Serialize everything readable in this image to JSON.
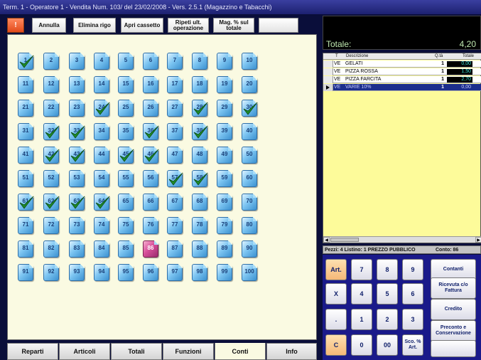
{
  "window": {
    "title": "Term. 1 - Operatore 1 - Vendita Num. 103/ del 23/02/2008 - Vers. 2.5.1 (Magazzino e Tabacchi)"
  },
  "toolbar": {
    "red_button": "!",
    "buttons": [
      "Annulla",
      "Elimina rigo",
      "Apri cassetto",
      "Ripeti ult. operazione",
      "Mag. % sul totale",
      ""
    ]
  },
  "grid": {
    "numbers": [
      "1",
      "2",
      "3",
      "4",
      "5",
      "6",
      "7",
      "8",
      "9",
      "10",
      "11",
      "12",
      "13",
      "14",
      "15",
      "16",
      "17",
      "18",
      "19",
      "20",
      "21",
      "22",
      "23",
      "24",
      "25",
      "26",
      "27",
      "28",
      "29",
      "30",
      "31",
      "32",
      "33",
      "34",
      "35",
      "36",
      "37",
      "38",
      "39",
      "40",
      "41",
      "42",
      "43",
      "44",
      "45",
      "46",
      "47",
      "48",
      "49",
      "50",
      "51",
      "52",
      "53",
      "54",
      "55",
      "56",
      "57",
      "58",
      "59",
      "60",
      "61",
      "62",
      "63",
      "64",
      "65",
      "66",
      "67",
      "68",
      "69",
      "70",
      "71",
      "72",
      "73",
      "74",
      "75",
      "76",
      "77",
      "78",
      "79",
      "80",
      "81",
      "82",
      "83",
      "84",
      "85",
      "86",
      "87",
      "88",
      "89",
      "90",
      "91",
      "92",
      "93",
      "94",
      "95",
      "96",
      "97",
      "98",
      "99",
      "100"
    ],
    "checked": [
      1,
      24,
      28,
      30,
      32,
      33,
      36,
      38,
      42,
      43,
      45,
      46,
      57,
      58,
      61,
      62,
      63,
      64
    ],
    "selected": 86,
    "tile_color": "#5aaee6",
    "check_color": "#1e8c2a"
  },
  "tabs": [
    "Reparti",
    "Articoli",
    "Totali",
    "Funzioni",
    "Conti",
    "Info"
  ],
  "active_tab": "Conti",
  "totals": {
    "label": "Totale:",
    "value": "4,20"
  },
  "receipt": {
    "headers": [
      "T",
      "Descrizione",
      "Q.tà",
      "Totale"
    ],
    "rows": [
      {
        "type": "VE",
        "desc": "GELATI",
        "qty": "1",
        "total": "0,00"
      },
      {
        "type": "VE",
        "desc": "PIZZA ROSSA",
        "qty": "1",
        "total": "1,50"
      },
      {
        "type": "VE",
        "desc": "PIZZA FARCITA",
        "qty": "1",
        "total": "2,70"
      },
      {
        "type": "VE",
        "desc": "VARIE 10%",
        "qty": "1",
        "total": "0,00"
      }
    ]
  },
  "info_bar": {
    "left": "Pezzi: 4 Listino: 1 PREZZO PUBBLICO",
    "right": "Conto: 86"
  },
  "keypad": {
    "art": "Art.",
    "x": "X",
    "dot": ".",
    "c": "C",
    "digits": [
      "7",
      "8",
      "9",
      "4",
      "5",
      "6",
      "1",
      "2",
      "3",
      "0",
      "00"
    ],
    "sco": "Sco. % Art.",
    "actions": [
      "Contanti",
      "Ricevuta c/o Fattura",
      "Credito",
      "Preconto e Conservazione",
      ""
    ]
  }
}
